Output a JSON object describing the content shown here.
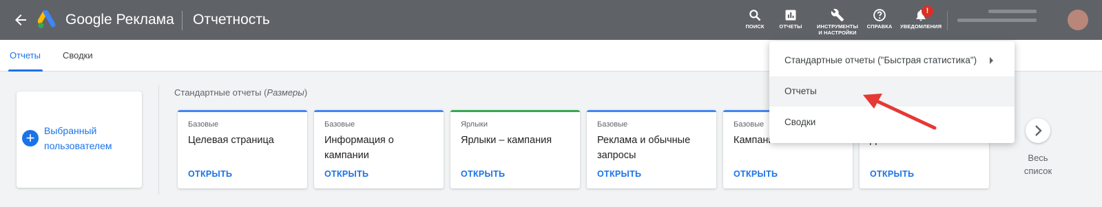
{
  "header": {
    "back_icon": "arrow-left-icon",
    "brand": "Google Реклама",
    "section_title": "Отчетность",
    "tools": [
      {
        "label": "ПОИСК",
        "icon": "search-icon"
      },
      {
        "label": "ОТЧЕТЫ",
        "icon": "bar-chart-icon"
      },
      {
        "label": "ИНСТРУМЕНТЫ И НАСТРОЙКИ",
        "icon": "wrench-icon"
      },
      {
        "label": "СПРАВКА",
        "icon": "help-icon"
      },
      {
        "label": "УВЕДОМЛЕНИЯ",
        "icon": "bell-icon",
        "badge": "!"
      }
    ]
  },
  "tabs": [
    {
      "label": "Отчеты",
      "active": true
    },
    {
      "label": "Сводки",
      "active": false
    }
  ],
  "favorites": {
    "label": "Выбранный пользователем",
    "icon": "plus-circle-icon"
  },
  "standard_reports": {
    "heading": "Стандартные отчеты (",
    "heading_italic": "Размеры",
    "heading_end": ")",
    "cards": [
      {
        "category": "Базовые",
        "title": "Целевая страница",
        "action": "ОТКРЫТЬ",
        "accent": "#4285f4"
      },
      {
        "category": "Базовые",
        "title": "Информация о кампании",
        "action": "ОТКРЫТЬ",
        "accent": "#4285f4"
      },
      {
        "category": "Ярлыки",
        "title": "Ярлыки – кампания",
        "action": "ОТКРЫТЬ",
        "accent": "#34a853"
      },
      {
        "category": "Базовые",
        "title": "Реклама и обычные запросы",
        "action": "ОТКРЫТЬ",
        "accent": "#4285f4"
      },
      {
        "category": "Базовые",
        "title": "Кампания",
        "action": "ОТКРЫТЬ",
        "accent": "#4285f4"
      },
      {
        "category": "",
        "title": "День",
        "action": "ОТКРЫТЬ",
        "accent": "#4285f4"
      }
    ],
    "next_icon": "chevron-right-icon",
    "all_list": "Весь список"
  },
  "dropdown": {
    "items": [
      {
        "label": "Стандартные отчеты (\"Быстрая статистика\")",
        "has_submenu": true
      },
      {
        "label": "Отчеты",
        "hover": true
      },
      {
        "label": "Сводки"
      }
    ]
  },
  "colors": {
    "topbar": "#5f6368",
    "accent_blue": "#1a73e8",
    "annotation_arrow": "#e53935"
  }
}
